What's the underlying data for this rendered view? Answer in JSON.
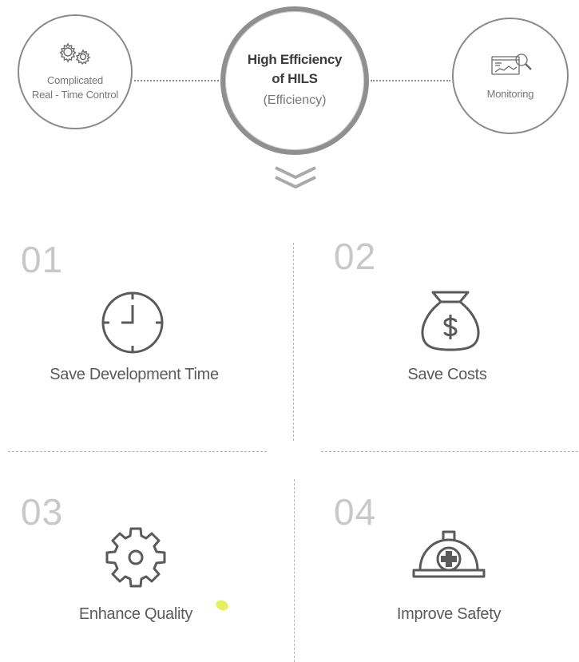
{
  "header": {
    "left_circle": {
      "line1": "Complicated",
      "line2": "Real - Time Control",
      "icon": "gears-icon"
    },
    "center_circle": {
      "title_line1": "High Efficiency",
      "title_line2": "of HILS",
      "subtitle": "(Efficiency)"
    },
    "right_circle": {
      "label": "Monitoring",
      "icon": "monitoring-icon"
    },
    "arrow_icon": "double-chevron-down-icon"
  },
  "benefits": [
    {
      "number": "01",
      "label": "Save Development Time",
      "icon": "clock-icon"
    },
    {
      "number": "02",
      "label": "Save Costs",
      "icon": "money-bag-icon"
    },
    {
      "number": "03",
      "label": "Enhance Quality",
      "icon": "gear-icon"
    },
    {
      "number": "04",
      "label": "Improve Safety",
      "icon": "hard-hat-icon"
    }
  ],
  "colors": {
    "stroke": "#5a5a5a",
    "number": "#c8c8c8",
    "accent_dot": "#e3f25a"
  }
}
